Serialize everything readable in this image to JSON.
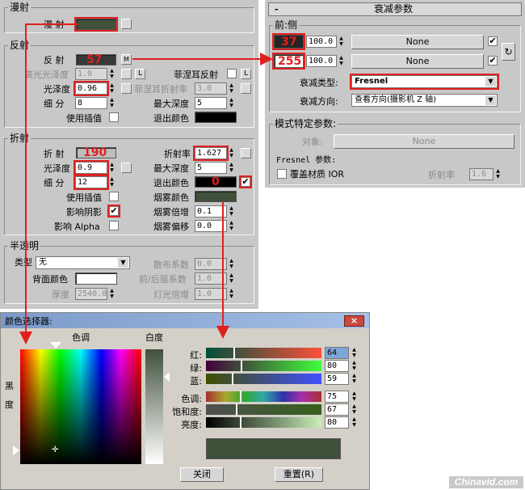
{
  "left": {
    "diffuse_group": "漫射",
    "diffuse_label": "漫 射",
    "reflect_group": "反射",
    "reflect_label": "反 射",
    "reflect_value": "57",
    "reflect_map_btn": "M",
    "hilight_gloss_label": "高光光泽度",
    "hilight_gloss_value": "1.0",
    "l_btn": "L",
    "fresnel_label": "菲涅耳反射",
    "gloss_label": "光泽度",
    "gloss_value": "0.96",
    "fresnel_ior_label": "菲涅耳折射率",
    "fresnel_ior_value": "3.0",
    "subdivs_label": "细 分",
    "subdivs_value": "8",
    "max_depth_label": "最大深度",
    "max_depth_value": "5",
    "use_interp_label": "使用插值",
    "exit_color_label": "退出颜色",
    "refract_group": "折射",
    "refract_label": "折 射",
    "refract_value": "190",
    "ior_label": "折射率",
    "ior_value": "1.627",
    "r_gloss_label": "光泽度",
    "r_gloss_value": "0.9",
    "r_max_depth_label": "最大深度",
    "r_max_depth_value": "5",
    "r_subdivs_label": "细 分",
    "r_subdivs_value": "12",
    "r_exit_label": "退出颜色",
    "r_exit_value": "0",
    "r_use_interp_label": "使用插值",
    "fog_color_label": "烟雾颜色",
    "affect_shadows_label": "影响阴影",
    "fog_mult_label": "烟雾倍增",
    "fog_mult_value": "0.1",
    "affect_alpha_label": "影响 Alpha",
    "fog_bias_label": "烟雾偏移",
    "fog_bias_value": "0.0",
    "translucency_group": "半透明",
    "type_label": "类型",
    "type_value": "无",
    "scatter_label": "散布系数",
    "scatter_value": "0.0",
    "back_color_label": "背面颜色",
    "fb_label": "前/后驱系数",
    "fb_value": "1.0",
    "thickness_label": "厚度",
    "thickness_value": "2540.0",
    "light_mult_label": "灯光倍增",
    "light_mult_value": "1.0"
  },
  "right": {
    "title_minus": "-",
    "title": "衰减参数",
    "front_side_label": "前:侧",
    "front_value": "37",
    "front_pct": "100.0",
    "none1": "None",
    "side_value": "255",
    "side_pct": "100.0",
    "none2": "None",
    "falloff_type_label": "衰减类型:",
    "falloff_type_value": "Fresnel",
    "falloff_dir_label": "衰减方向:",
    "falloff_dir_value": "查看方向(摄影机 Z 轴)",
    "mode_group": "模式特定参数:",
    "object_label": "对象:",
    "object_value": "None",
    "fresnel_params_label": "Fresnel 参数:",
    "override_ior_label": "覆盖材质 IOR",
    "ior_label": "折射率",
    "ior_value": "1.6"
  },
  "picker": {
    "title": "颜色选择器:",
    "hue_label": "色调",
    "white_label": "白度",
    "black_label": "黑",
    "degree_label": "度",
    "red_label": "红:",
    "red_value": "64",
    "green_label": "绿:",
    "green_value": "80",
    "blue_label": "蓝:",
    "blue_value": "59",
    "hue2_label": "色调:",
    "hue_value": "75",
    "sat_label": "饱和度:",
    "sat_value": "67",
    "val_label": "亮度:",
    "val_value": "80",
    "close_btn": "关闭",
    "reset_btn": "重置(R)",
    "close_x": "×",
    "swatch_color": "#40503b"
  },
  "watermark": "Chinavid.com",
  "colors": {
    "highlight": "#e02020",
    "panel": "#c8c8c8",
    "titlebar": "#7b9ac8"
  }
}
